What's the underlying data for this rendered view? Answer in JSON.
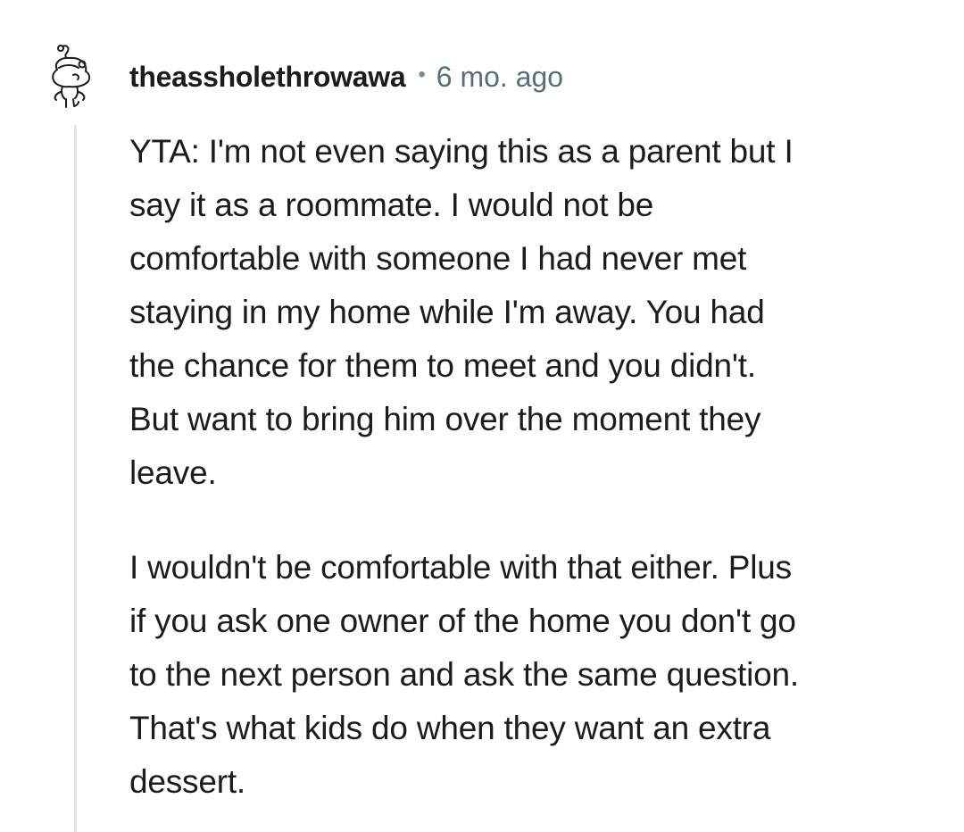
{
  "comment": {
    "author": "theassholethrowawa",
    "separator": "•",
    "timestamp": "6 mo. ago",
    "avatar_icon": "snoo-avatar-icon",
    "paragraphs": [
      [
        "YTA: I'm not even saying this as a parent but I",
        "say it as a roommate. I would not be",
        "comfortable with someone I had never met",
        "staying in my home while I'm away. You had",
        "the chance for them to meet and you didn't.",
        "But want to bring him over the moment they",
        "leave."
      ],
      [
        "I wouldn't be comfortable with that either. Plus",
        "if you ask one owner of the home you don't go",
        "to the next person and ask the same question.",
        "That's what kids do when they want an extra",
        "dessert."
      ]
    ]
  },
  "colors": {
    "text": "#1c1c1c",
    "meta": "#576f76",
    "thread_line": "#e4e6e8",
    "background": "#ffffff"
  }
}
